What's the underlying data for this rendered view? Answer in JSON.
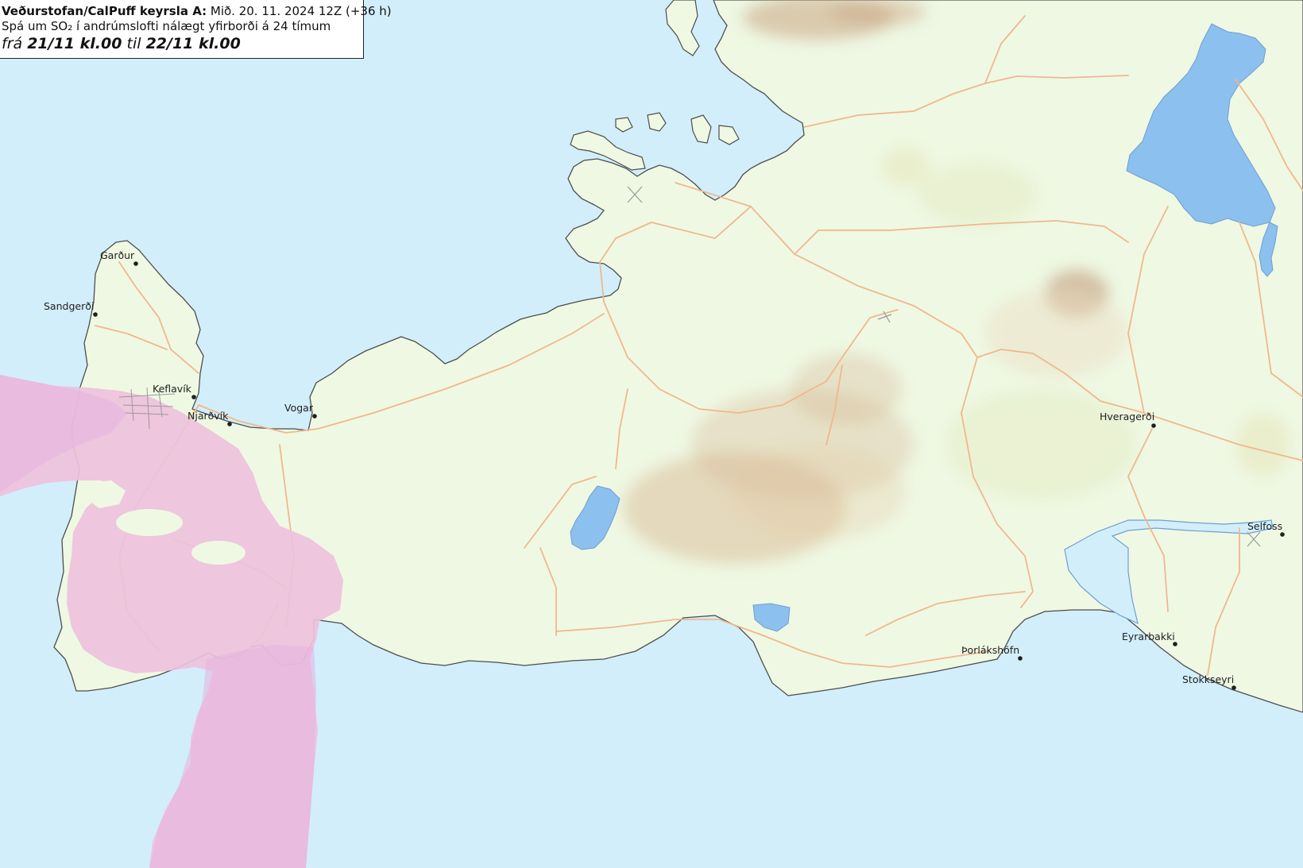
{
  "legend": {
    "source": "Veðurstofan/CalPuff keyrsla A:",
    "run_time": "Mið. 20. 11. 2024 12Z (+36 h)",
    "description": "Spá um SO₂ í andrúmslofti nálægt yfirborði á 24 tímum",
    "from_word": "frá",
    "from_time": "21/11 kl.00",
    "to_word": "til",
    "to_time": "22/11 kl.00"
  },
  "towns": [
    {
      "name": "Garður"
    },
    {
      "name": "Sandgerði"
    },
    {
      "name": "Keflavík"
    },
    {
      "name": "Njarðvík"
    },
    {
      "name": "Vogar"
    },
    {
      "name": "Hveragerði"
    },
    {
      "name": "Selfoss"
    },
    {
      "name": "Þorlákshöfn"
    },
    {
      "name": "Eyrarbakki"
    },
    {
      "name": "Stokkseyri"
    }
  ],
  "colors": {
    "sea": "#d2eefb",
    "land": "#eff8e3",
    "lake": "#8cc0ef",
    "road": "#f0b88e",
    "so2_plume": "#f0a6d6",
    "relief": "#c5a27c"
  }
}
